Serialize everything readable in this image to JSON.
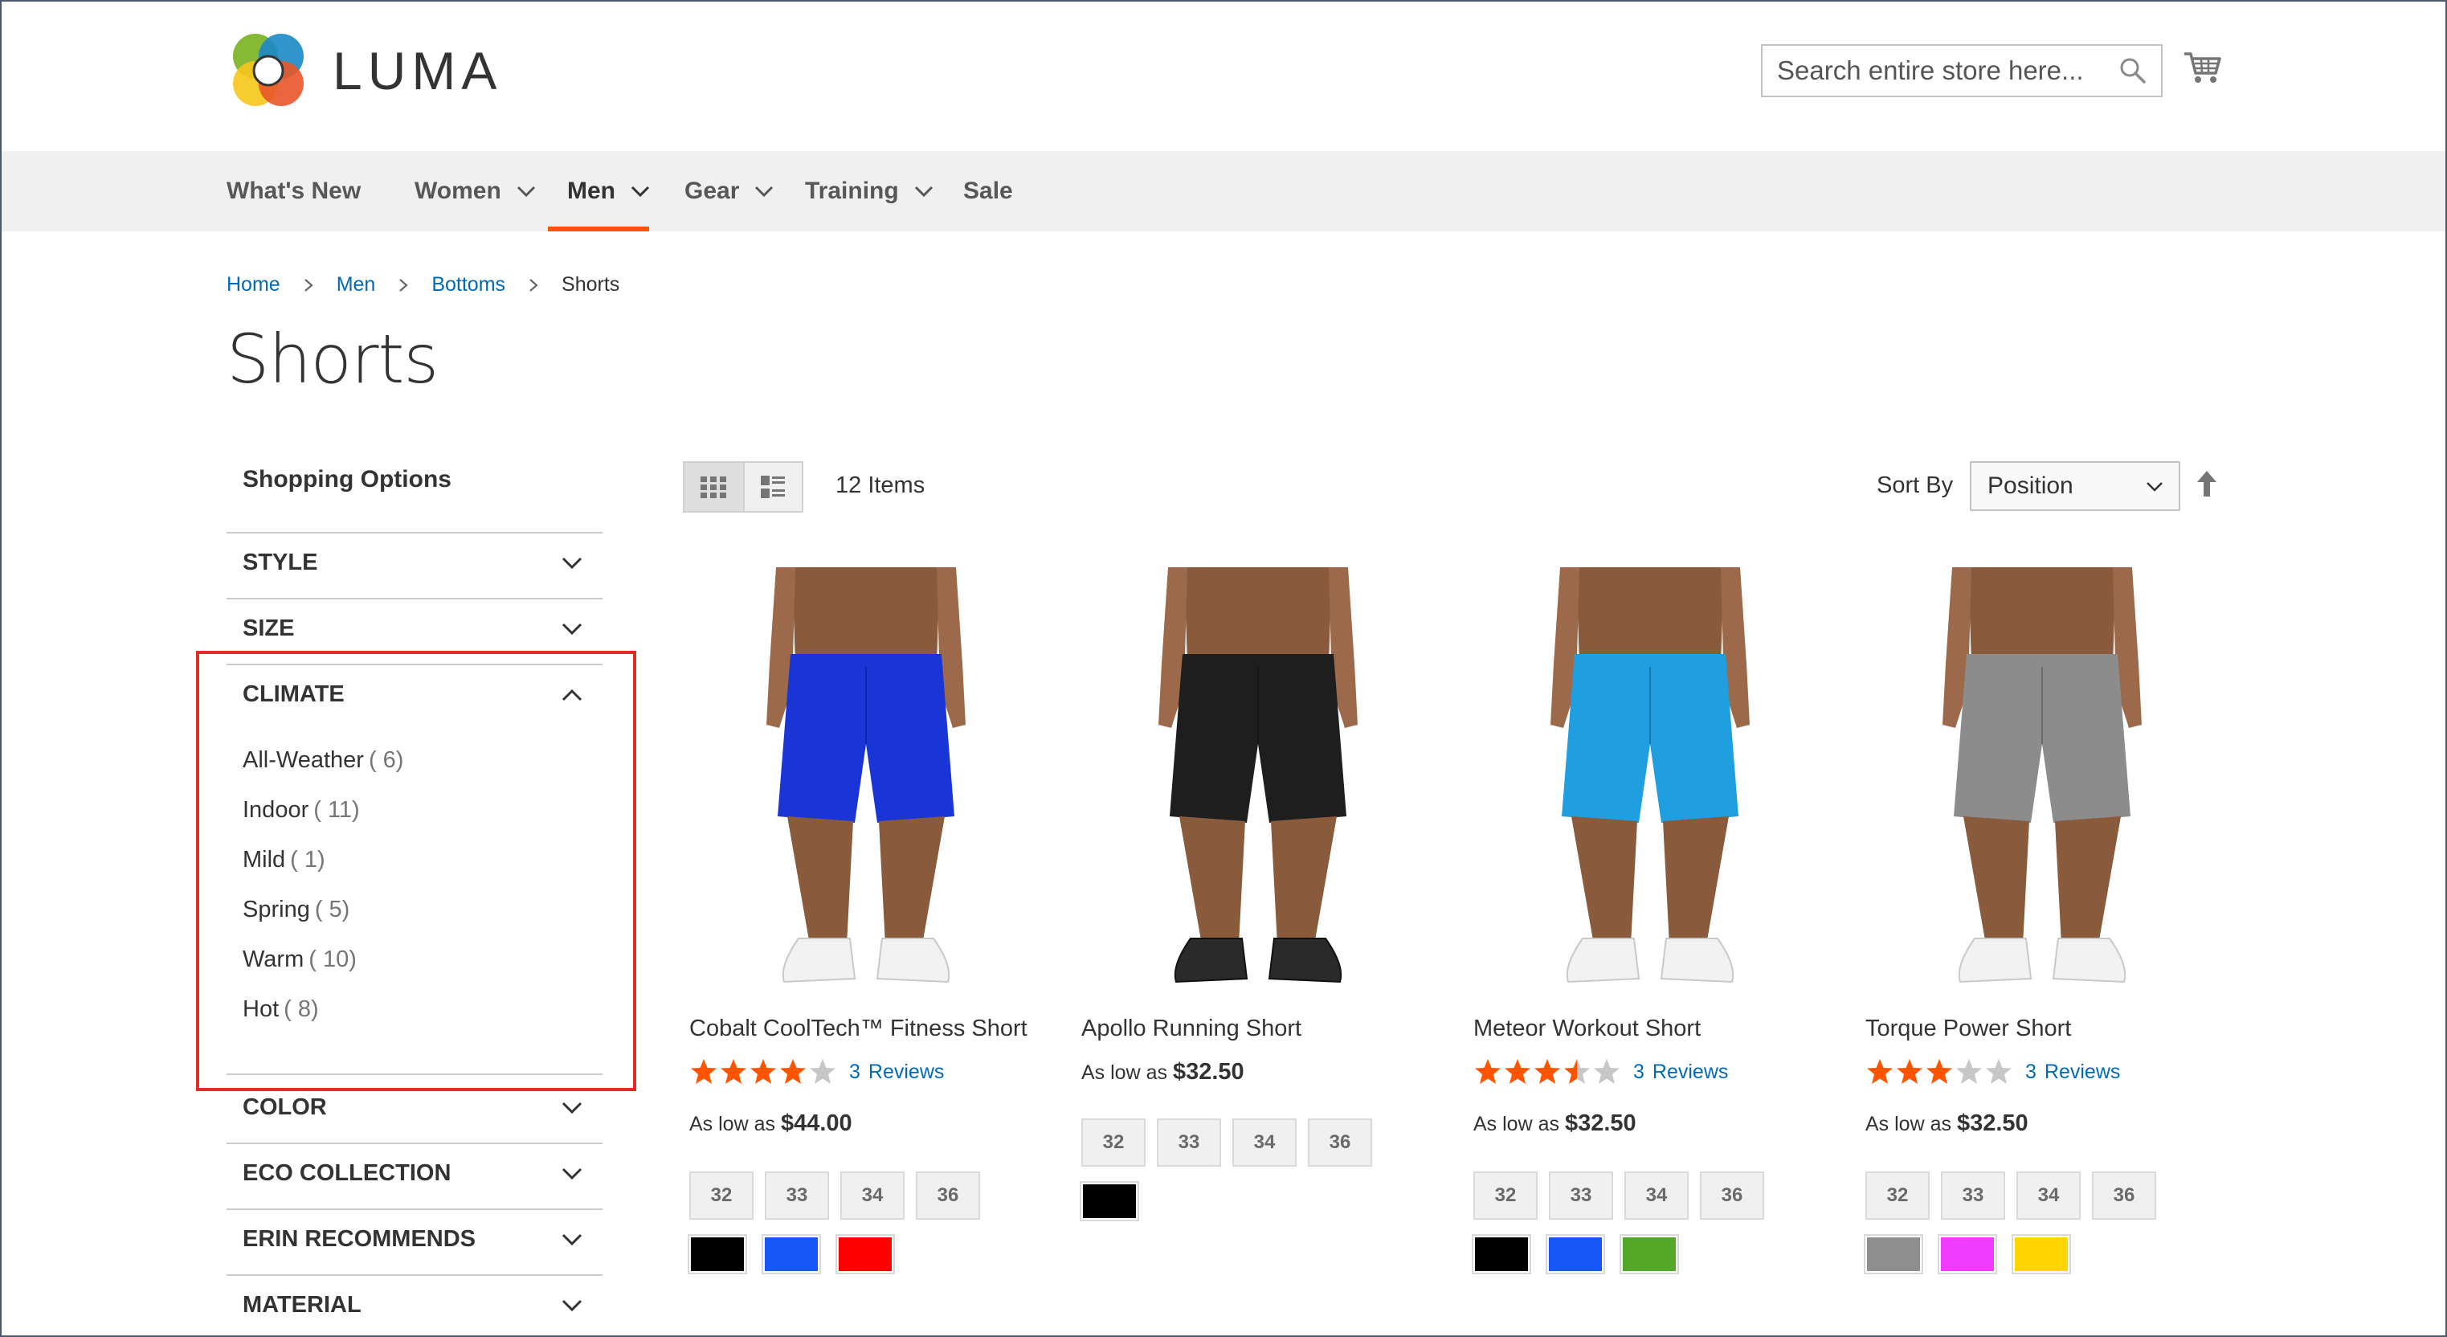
{
  "brand": {
    "name": "LUMA"
  },
  "search": {
    "placeholder": "Search entire store here..."
  },
  "nav": {
    "items": [
      {
        "label": "What's New"
      },
      {
        "label": "Women"
      },
      {
        "label": "Men"
      },
      {
        "label": "Gear"
      },
      {
        "label": "Training"
      },
      {
        "label": "Sale"
      }
    ]
  },
  "breadcrumb": {
    "items": [
      {
        "label": "Home"
      },
      {
        "label": "Men"
      },
      {
        "label": "Bottoms"
      }
    ],
    "current": "Shorts"
  },
  "page_title": "Shorts",
  "sidebar": {
    "title": "Shopping Options",
    "filters": [
      {
        "label": "STYLE"
      },
      {
        "label": "SIZE"
      },
      {
        "label": "CLIMATE"
      },
      {
        "label": "COLOR"
      },
      {
        "label": "ECO COLLECTION"
      },
      {
        "label": "ERIN RECOMMENDS"
      },
      {
        "label": "MATERIAL"
      }
    ],
    "climate_options": [
      {
        "label": "All-Weather",
        "count": "( 6)"
      },
      {
        "label": "Indoor",
        "count": "( 11)"
      },
      {
        "label": "Mild",
        "count": "( 1)"
      },
      {
        "label": "Spring",
        "count": "( 5)"
      },
      {
        "label": "Warm",
        "count": "( 10)"
      },
      {
        "label": "Hot",
        "count": "( 8)"
      }
    ]
  },
  "toolbar": {
    "items_count": "12 Items",
    "sort_label": "Sort By",
    "sort_value": "Position"
  },
  "colors": {
    "accent": "#ff5501",
    "link": "#006bb4",
    "star": "#ff5501",
    "highlight": "#e02b27"
  },
  "products": [
    {
      "name": "Cobalt CoolTech™ Fitness Short",
      "rating": 4,
      "review_count": "3",
      "reviews_label": "Reviews",
      "price_prefix": "As low as",
      "price": "$44.00",
      "short_color": "#1a35d6",
      "shoe": "white",
      "sizes": [
        "32",
        "33",
        "34",
        "36"
      ],
      "colors": [
        "#000000",
        "#1857f7",
        "#ff0000"
      ]
    },
    {
      "name": "Apollo Running Short",
      "rating": null,
      "review_count": "",
      "reviews_label": "",
      "price_prefix": "As low as",
      "price": "$32.50",
      "short_color": "#1e1e1e",
      "shoe": "dark",
      "sizes": [
        "32",
        "33",
        "34",
        "36"
      ],
      "colors": [
        "#000000"
      ]
    },
    {
      "name": "Meteor Workout Short",
      "rating": 3.5,
      "review_count": "3",
      "reviews_label": "Reviews",
      "price_prefix": "As low as",
      "price": "$32.50",
      "short_color": "#1f9fe0",
      "shoe": "white",
      "sizes": [
        "32",
        "33",
        "34",
        "36"
      ],
      "colors": [
        "#000000",
        "#1857f7",
        "#53a828"
      ]
    },
    {
      "name": "Torque Power Short",
      "rating": 3,
      "review_count": "3",
      "reviews_label": "Reviews",
      "price_prefix": "As low as",
      "price": "$32.50",
      "short_color": "#8c8c8c",
      "shoe": "white",
      "sizes": [
        "32",
        "33",
        "34",
        "36"
      ],
      "colors": [
        "#8f8f8f",
        "#ef3dff",
        "#ffd500"
      ]
    }
  ]
}
